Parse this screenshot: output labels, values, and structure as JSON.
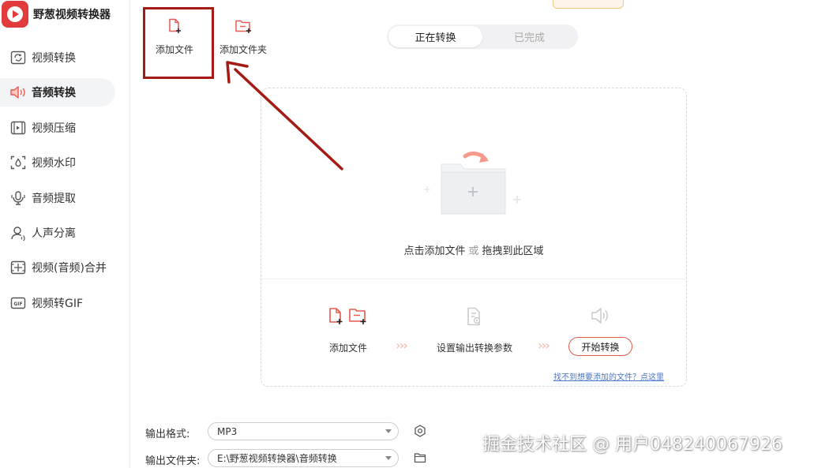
{
  "app": {
    "title": "野葱视频转换器"
  },
  "sidebar": {
    "items": [
      {
        "label": "视频转换",
        "icon": "video-convert-icon",
        "active": false
      },
      {
        "label": "音频转换",
        "icon": "audio-convert-icon",
        "active": true
      },
      {
        "label": "视频压缩",
        "icon": "video-compress-icon",
        "active": false
      },
      {
        "label": "视频水印",
        "icon": "video-watermark-icon",
        "active": false
      },
      {
        "label": "音频提取",
        "icon": "audio-extract-icon",
        "active": false
      },
      {
        "label": "人声分离",
        "icon": "voice-separation-icon",
        "active": false
      },
      {
        "label": "视频(音频)合并",
        "icon": "merge-icon",
        "active": false
      },
      {
        "label": "视频转GIF",
        "icon": "gif-icon",
        "active": false
      }
    ]
  },
  "toolbar": {
    "add_file_label": "添加文件",
    "add_folder_label": "添加文件夹"
  },
  "tabs": {
    "converting": "正在转换",
    "completed": "已完成"
  },
  "drop_area": {
    "hint_click": "点击添加文件",
    "hint_or": "或",
    "hint_drag": "拖拽到此区域",
    "step1_label": "添加文件",
    "step2_label": "设置输出转换参数",
    "start_button": "开始转换",
    "help_link": "找不到想要添加的文件？点这里"
  },
  "output": {
    "format_label": "输出格式:",
    "format_value": "MP3",
    "folder_label": "输出文件夹:",
    "folder_value": "E:\\野葱视频转换器\\音频转换"
  },
  "watermark": "掘金技术社区 @ 用户048240067926",
  "colors": {
    "accent": "#e55a4d",
    "annotation": "#a31b14",
    "link": "#4a76c9"
  }
}
